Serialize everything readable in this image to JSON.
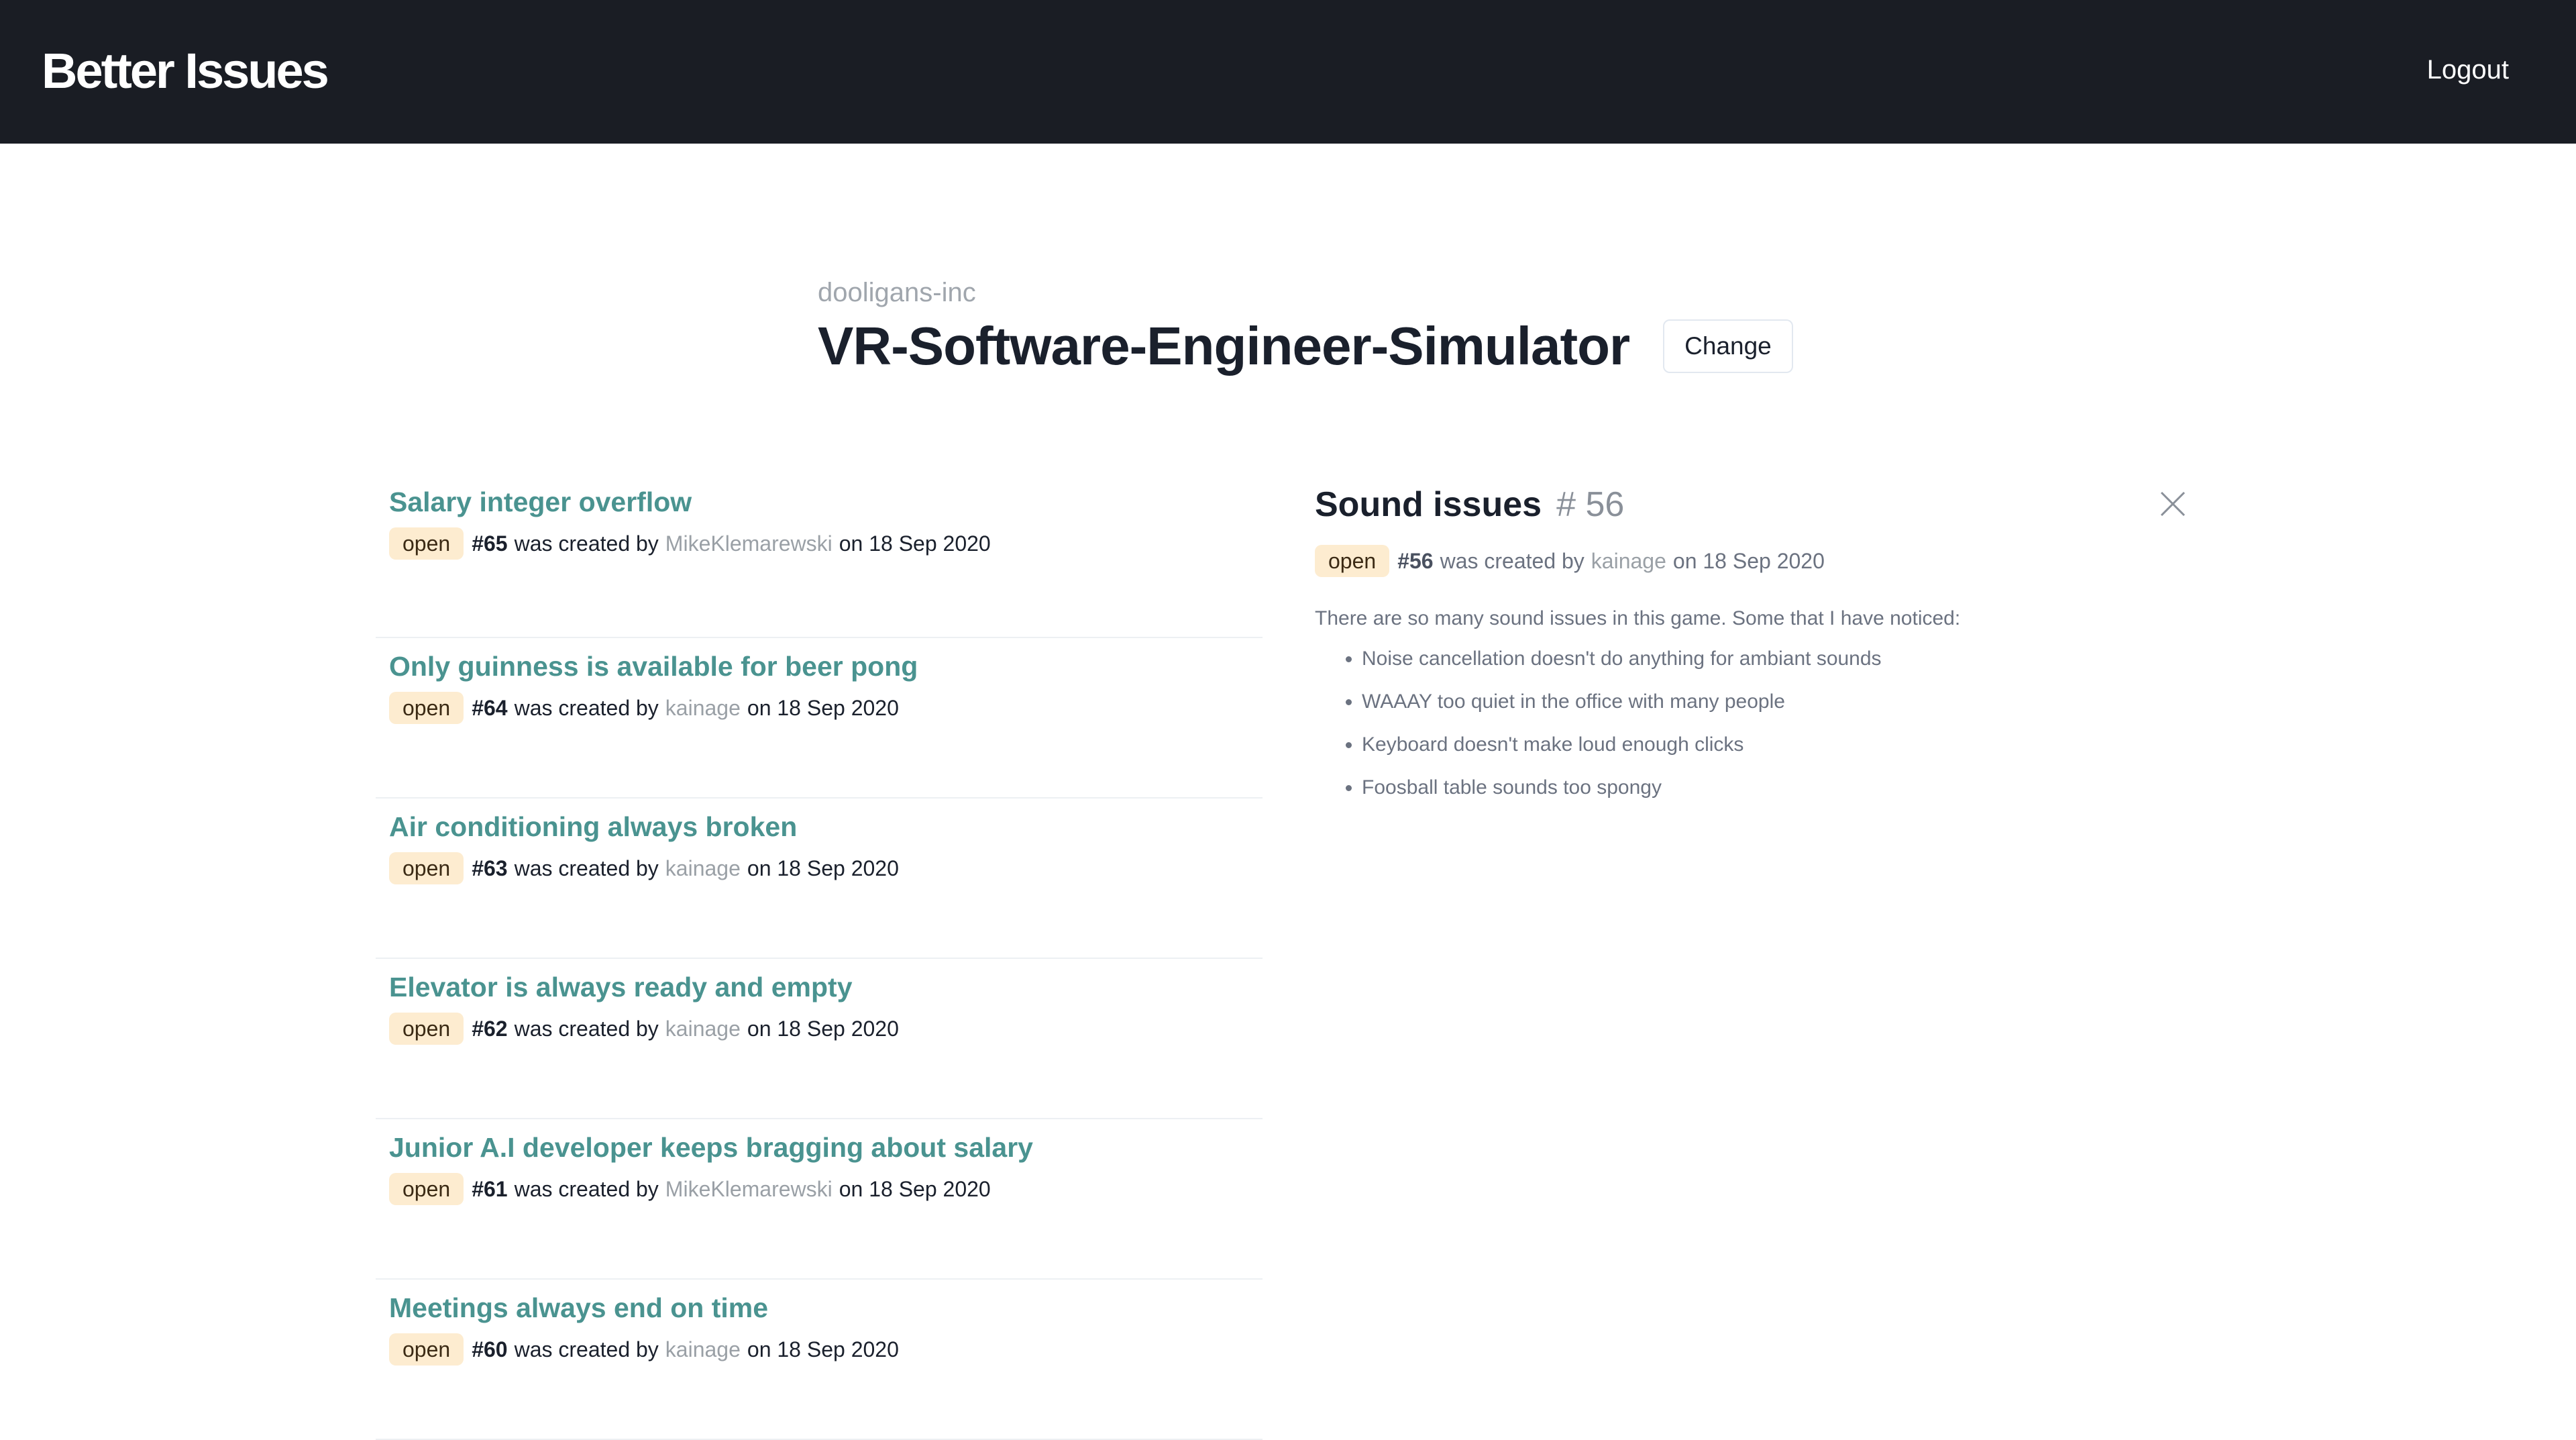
{
  "header": {
    "brand": "Better Issues",
    "logout_label": "Logout"
  },
  "repo": {
    "org": "dooligans-inc",
    "name": "VR-Software-Engineer-Simulator",
    "change_label": "Change"
  },
  "issues": [
    {
      "title": "Salary integer overflow",
      "status": "open",
      "number": "#65",
      "created_text": "was created by",
      "user": "MikeKlemarewski",
      "date_text": "on 18 Sep 2020"
    },
    {
      "title": "Only guinness is available for beer pong",
      "status": "open",
      "number": "#64",
      "created_text": "was created by",
      "user": "kainage",
      "date_text": "on 18 Sep 2020"
    },
    {
      "title": "Air conditioning always broken",
      "status": "open",
      "number": "#63",
      "created_text": "was created by",
      "user": "kainage",
      "date_text": "on 18 Sep 2020"
    },
    {
      "title": "Elevator is always ready and empty",
      "status": "open",
      "number": "#62",
      "created_text": "was created by",
      "user": "kainage",
      "date_text": "on 18 Sep 2020"
    },
    {
      "title": "Junior A.I developer keeps bragging about salary",
      "status": "open",
      "number": "#61",
      "created_text": "was created by",
      "user": "MikeKlemarewski",
      "date_text": "on 18 Sep 2020"
    },
    {
      "title": "Meetings always end on time",
      "status": "open",
      "number": "#60",
      "created_text": "was created by",
      "user": "kainage",
      "date_text": "on 18 Sep 2020"
    }
  ],
  "detail": {
    "title": "Sound issues",
    "number_label": "# 56",
    "status": "open",
    "number": "#56",
    "created_text": "was created by",
    "user": "kainage",
    "date_text": "on 18 Sep 2020",
    "intro": "There are so many sound issues in this game. Some that I have noticed:",
    "points": [
      "Noise cancellation doesn't do anything for ambiant sounds",
      "WAAAY too quiet in the office with many people",
      "Keyboard doesn't make loud enough clicks",
      "Foosball table sounds too spongy"
    ],
    "close_icon": "close-icon"
  },
  "colors": {
    "topbar": "#1a1d24",
    "issue_title": "#4a9390",
    "badge_bg": "#fdecd0"
  }
}
